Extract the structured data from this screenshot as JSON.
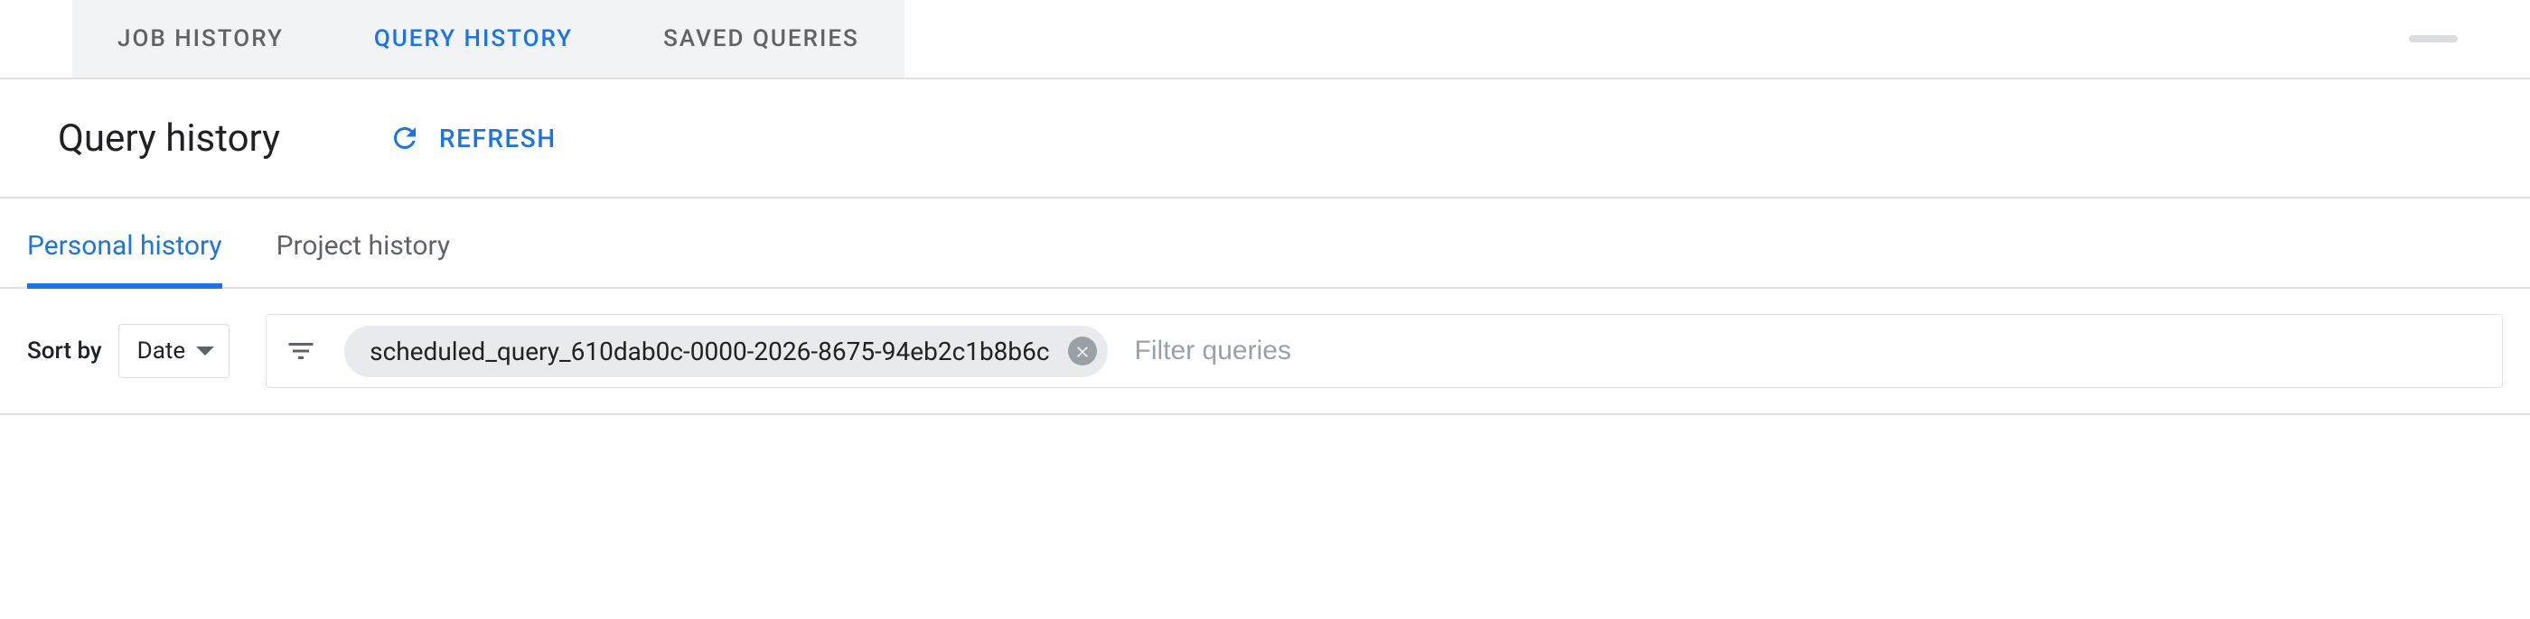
{
  "top_tabs": [
    {
      "label": "JOB HISTORY",
      "active": false
    },
    {
      "label": "QUERY HISTORY",
      "active": true
    },
    {
      "label": "SAVED QUERIES",
      "active": false
    }
  ],
  "page_title": "Query history",
  "refresh_label": "REFRESH",
  "sub_tabs": [
    {
      "label": "Personal history",
      "active": true
    },
    {
      "label": "Project history",
      "active": false
    }
  ],
  "sort": {
    "label": "Sort by",
    "selected": "Date"
  },
  "filter": {
    "chips": [
      {
        "text": "scheduled_query_610dab0c-0000-2026-8675-94eb2c1b8b6c"
      }
    ],
    "placeholder": "Filter queries"
  },
  "colors": {
    "accent": "#1a73e8",
    "text_secondary": "#5f6368",
    "chip_bg": "#e8eaed"
  }
}
